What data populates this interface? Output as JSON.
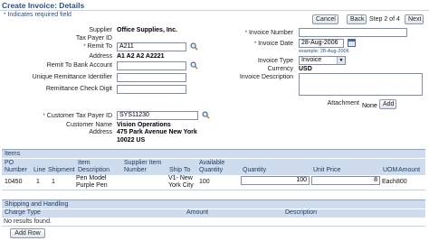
{
  "page": {
    "title": "Create Invoice: Details",
    "required_note": "Indicates required field"
  },
  "nav": {
    "cancel": "Cancel",
    "back": "Back",
    "step": "Step 2 of 4",
    "next": "Next"
  },
  "form": {
    "supplier_label": "Supplier",
    "supplier_value": "Office Supplies, Inc.",
    "tax_payer_id_label": "Tax Payer ID",
    "remit_to_label": "Remit To",
    "remit_to_value": "A211",
    "address_label": "Address",
    "address_value": "A1 A2 A2 A2221",
    "remit_bank_label": "Remit To Bank Account",
    "unique_remit_label": "Unique Remittance Identifier",
    "remit_check_label": "Remittance Check Digit",
    "invoice_number_label": "Invoice Number",
    "invoice_date_label": "Invoice Date",
    "invoice_date_value": "28-Aug-2006",
    "invoice_date_example": "example: 28-Aug-2006",
    "invoice_type_label": "Invoice Type",
    "invoice_type_value": "Invoice",
    "currency_label": "Currency",
    "currency_value": "USD",
    "invoice_desc_label": "Invoice Description",
    "attachment_label": "Attachment",
    "attachment_value": "None",
    "attachment_add": "Add",
    "customer_tax_label": "Customer Tax Payer ID",
    "customer_tax_value": "SYS11230",
    "customer_name_label": "Customer Name",
    "customer_name_value": "Vision Operations",
    "customer_address_label": "Address",
    "customer_address_line1": "475 Park Avenue New York",
    "customer_address_line2": "10022 US"
  },
  "items": {
    "header": "Items",
    "columns": {
      "po_number": "PO Number",
      "line": "Line",
      "shipment": "Shipment",
      "item_description": "Item Description",
      "supplier_item_number": "Supplier Item Number",
      "ship_to": "Ship To",
      "available_quantity": "Available Quantity",
      "quantity": "Quantity",
      "unit_price": "Unit Price",
      "uom": "UOM",
      "amount": "Amount"
    },
    "rows": [
      {
        "po_number": "10450",
        "line": "1",
        "shipment": "1",
        "item_description": "Pen Model Purple Pen",
        "supplier_item_number": "",
        "ship_to": "V1- New York City",
        "available_quantity": "100",
        "quantity": "100",
        "unit_price": "8",
        "uom": "Each",
        "amount": "800"
      }
    ]
  },
  "shipping": {
    "header": "Shipping and Handling",
    "columns": {
      "charge_type": "Charge Type",
      "amount": "Amount",
      "description": "Description"
    },
    "empty": "No results found.",
    "add_row": "Add Row"
  },
  "icons": [
    "search-icon",
    "calendar-icon",
    "chevron-down-icon"
  ],
  "colors": {
    "accent": "#2b5085",
    "header_bg": "#cfdced"
  }
}
